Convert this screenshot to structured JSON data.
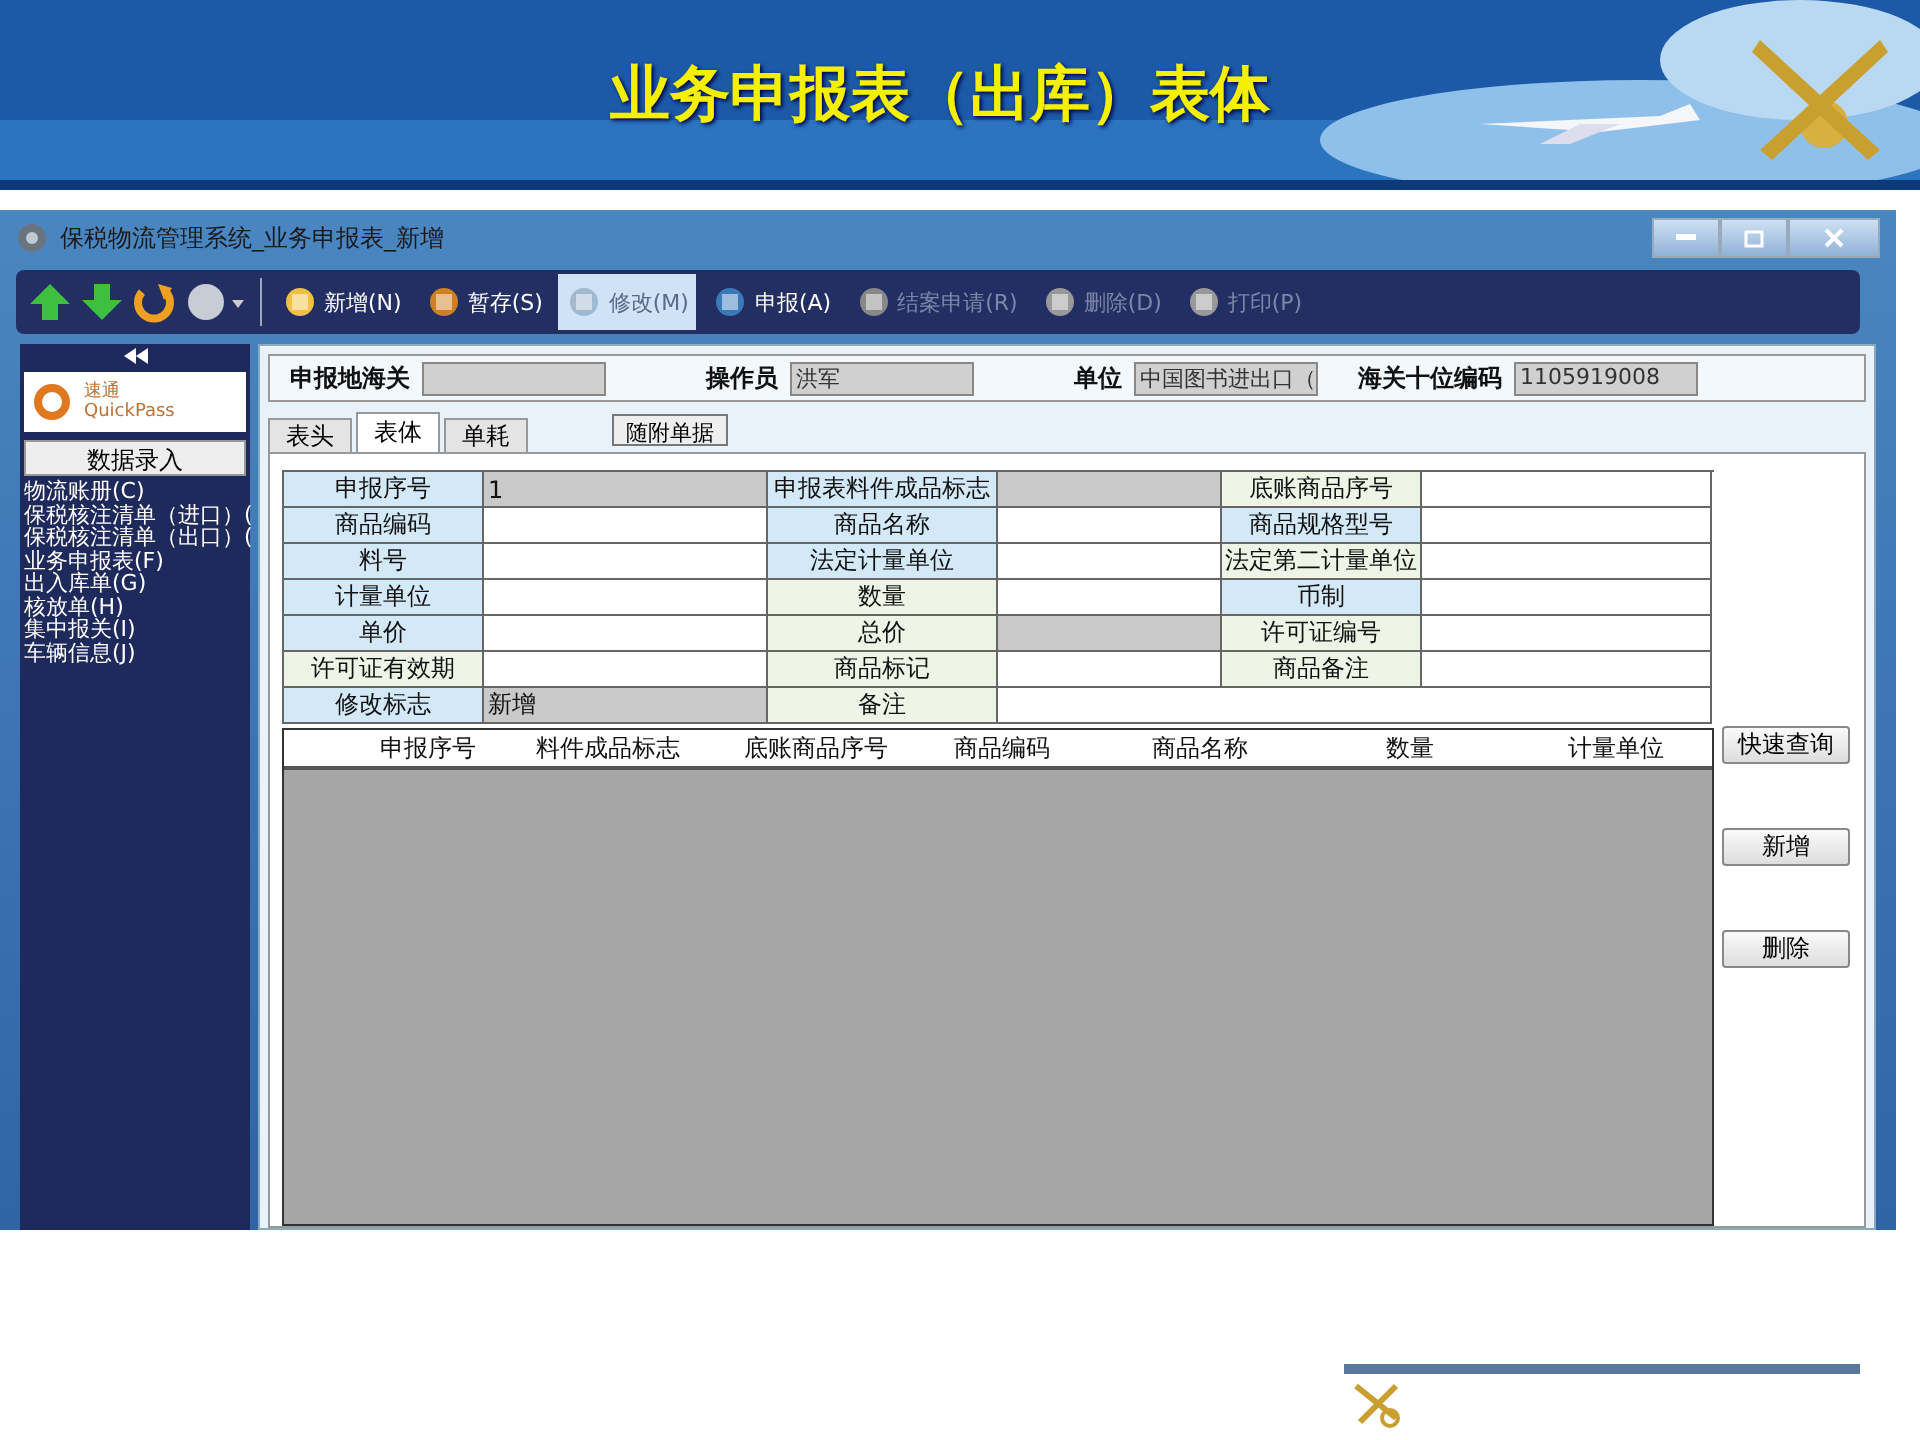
{
  "slide": {
    "title": "业务申报表（出库）表体"
  },
  "window": {
    "title": "保税物流管理系统_业务申报表_新增"
  },
  "toolbar": [
    {
      "label": "新增(N)",
      "disabled": false,
      "selected": false
    },
    {
      "label": "暂存(S)",
      "disabled": false,
      "selected": false
    },
    {
      "label": "修改(M)",
      "disabled": true,
      "selected": true
    },
    {
      "label": "申报(A)",
      "disabled": false,
      "selected": false
    },
    {
      "label": "结案申请(R)",
      "disabled": true,
      "selected": false
    },
    {
      "label": "删除(D)",
      "disabled": true,
      "selected": false
    },
    {
      "label": "打印(P)",
      "disabled": true,
      "selected": false
    }
  ],
  "sidebar": {
    "logo_text": "速通",
    "logo_subtext": "QuickPass",
    "section_button": "数据录入",
    "items": [
      "物流账册(C)",
      "保税核注清单（进口）(",
      "保税核注清单（出口）(",
      "业务申报表(F)",
      "出入库单(G)",
      "核放单(H)",
      "集中报关(I)",
      "车辆信息(J)"
    ]
  },
  "header_fields": [
    {
      "label": "申报地海关"
    },
    {
      "label": "操作员",
      "value": "洪军"
    },
    {
      "label": "单位",
      "value": "中国图书进出口（"
    },
    {
      "label": "海关十位编码",
      "value": "1105919008"
    }
  ],
  "tabs": [
    {
      "label": "表头",
      "selected": false
    },
    {
      "label": "表体",
      "selected": true
    },
    {
      "label": "单耗",
      "selected": false
    }
  ],
  "attachment_button": "随附单据",
  "form": {
    "rows": [
      [
        {
          "label": "申报序号",
          "color": "#d3e9f8",
          "value": "1",
          "disabled": true
        },
        {
          "label": "申报表料件成品标志",
          "color": "#d3e9f8",
          "disabled": true
        },
        {
          "label": "底账商品序号",
          "color": "#eef4e6",
          "disabled": false
        }
      ],
      [
        {
          "label": "商品编码",
          "color": "#d3e9f8",
          "disabled": false
        },
        {
          "label": "商品名称",
          "color": "#d3e9f8",
          "disabled": false
        },
        {
          "label": "商品规格型号",
          "color": "#d3e9f8",
          "disabled": false
        }
      ],
      [
        {
          "label": "料号",
          "color": "#d3e9f8",
          "disabled": false
        },
        {
          "label": "法定计量单位",
          "color": "#d3e9f8",
          "disabled": false
        },
        {
          "label": "法定第二计量单位",
          "color": "#eef4e6",
          "disabled": false
        }
      ],
      [
        {
          "label": "计量单位",
          "color": "#d3e9f8",
          "disabled": false
        },
        {
          "label": "数量",
          "color": "#eef4e6",
          "disabled": false
        },
        {
          "label": "币制",
          "color": "#d3e9f8",
          "disabled": false
        }
      ],
      [
        {
          "label": "单价",
          "color": "#d3e9f8",
          "disabled": false
        },
        {
          "label": "总价",
          "color": "#eef4e6",
          "disabled": true
        },
        {
          "label": "许可证编号",
          "color": "#eef4e6",
          "disabled": false
        }
      ],
      [
        {
          "label": "许可证有效期",
          "color": "#eef4e6",
          "disabled": false
        },
        {
          "label": "商品标记",
          "color": "#eef4e6",
          "disabled": false
        },
        {
          "label": "商品备注",
          "color": "#eef4e6",
          "disabled": false
        }
      ],
      [
        {
          "label": "修改标志",
          "color": "#d3e9f8",
          "value": "新增",
          "disabled": true
        },
        {
          "label": "备注",
          "color": "#eef4e6",
          "disabled": false
        }
      ]
    ]
  },
  "list": {
    "columns": [
      "申报序号",
      "料件成品标志",
      "底账商品序号",
      "商品编码",
      "商品名称",
      "数量",
      "计量单位"
    ]
  },
  "side_buttons": [
    "快速查询",
    "新增",
    "删除"
  ]
}
